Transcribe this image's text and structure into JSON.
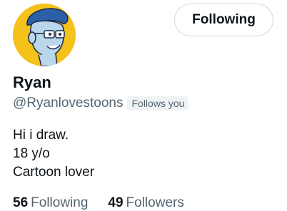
{
  "profile": {
    "name": "Ryan",
    "handle": "@Ryanlovestoons",
    "follows_you_badge": "Follows you",
    "bio": [
      "Hi i draw.",
      "18 y/o",
      "Cartoon lover"
    ],
    "avatar_icon": "cartoon-character-avatar",
    "avatar_bg": "#f4c21a"
  },
  "actions": {
    "follow_label": "Following"
  },
  "stats": {
    "following_count": "56",
    "following_label": "Following",
    "followers_count": "49",
    "followers_label": "Followers"
  },
  "colors": {
    "text": "#0f1419",
    "muted": "#536471",
    "badge_bg": "#eff3f4",
    "border": "#cfd9de"
  }
}
